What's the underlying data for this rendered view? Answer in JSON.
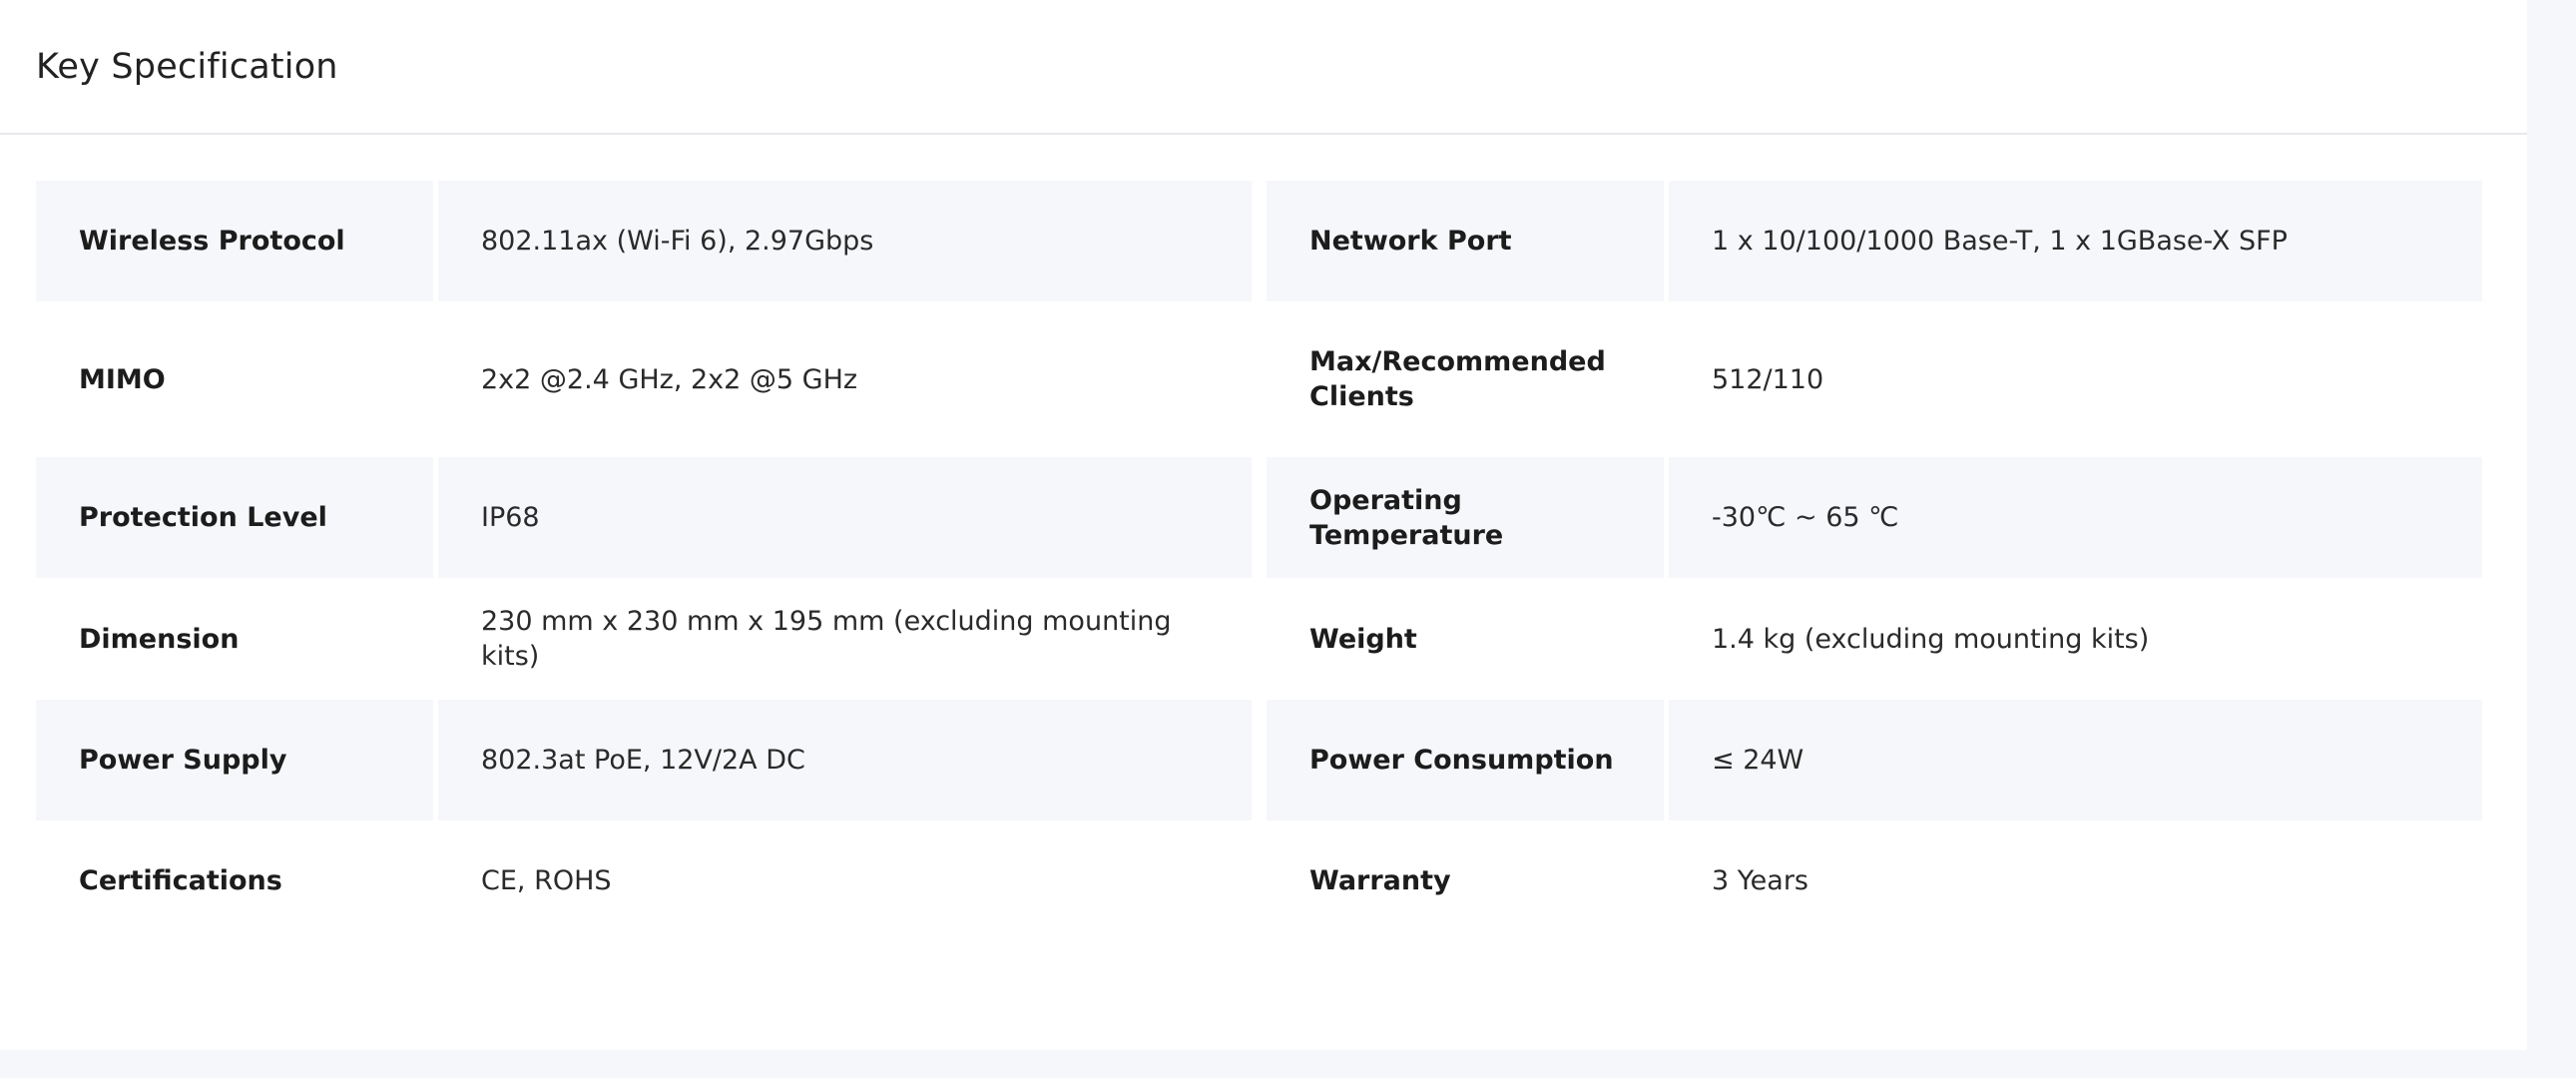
{
  "section": {
    "title": "Key Specification"
  },
  "specs": [
    {
      "left": {
        "label": "Wireless Protocol",
        "value": "802.11ax (Wi-Fi 6), 2.97Gbps"
      },
      "right": {
        "label": "Network Port",
        "value": "1 x 10/100/1000 Base-T, 1 x 1GBase-X SFP"
      }
    },
    {
      "left": {
        "label": "MIMO",
        "value": "2x2 @2.4 GHz, 2x2 @5 GHz"
      },
      "right": {
        "label": "Max/Recommended Clients",
        "value": "512/110"
      }
    },
    {
      "left": {
        "label": "Protection Level",
        "value": "IP68"
      },
      "right": {
        "label": "Operating Temperature",
        "value": "-30℃ ~ 65 ℃"
      }
    },
    {
      "left": {
        "label": "Dimension",
        "value": "230 mm x 230 mm x 195 mm (excluding mounting kits)"
      },
      "right": {
        "label": "Weight",
        "value": "1.4 kg (excluding mounting kits)"
      }
    },
    {
      "left": {
        "label": "Power Supply",
        "value": "802.3at PoE, 12V/2A DC"
      },
      "right": {
        "label": "Power Consumption",
        "value": "≤ 24W"
      }
    },
    {
      "left": {
        "label": "Certifications",
        "value": "CE, ROHS"
      },
      "right": {
        "label": "Warranty",
        "value": "3 Years"
      }
    }
  ],
  "colors": {
    "page_background": "#f6f7fa",
    "panel_background": "#ffffff",
    "striped_row": "#f6f7fb",
    "divider": "#e6e8ec",
    "label_text": "#1c1c1c",
    "value_text": "#2a2a2a"
  }
}
